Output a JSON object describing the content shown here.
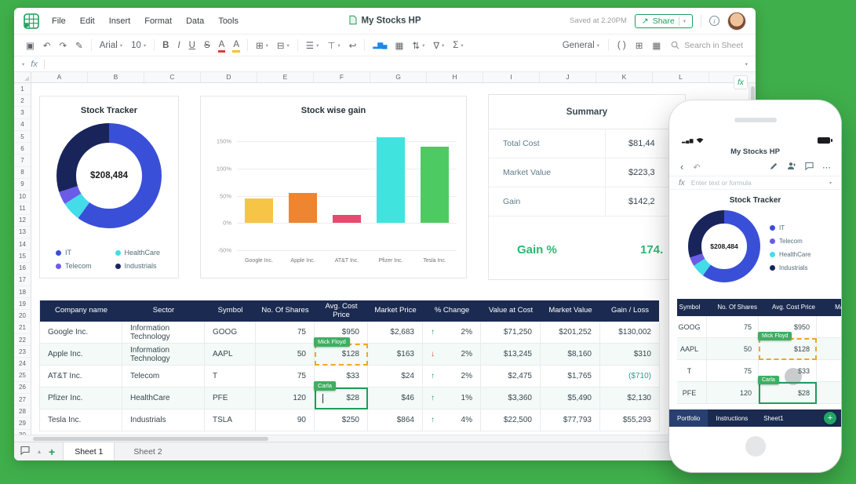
{
  "app": {
    "menu": [
      "File",
      "Edit",
      "Insert",
      "Format",
      "Data",
      "Tools"
    ],
    "doc_title": "My Stocks HP",
    "saved": "Saved at 2.20PM",
    "share": "Share",
    "font": "Arial",
    "font_size": "10",
    "number_format": "General",
    "search_placeholder": "Search in Sheet",
    "fx": "fx",
    "columns": [
      "A",
      "B",
      "C",
      "D",
      "E",
      "F",
      "G",
      "H",
      "I",
      "J",
      "K",
      "L"
    ],
    "row_numbers": [
      "1",
      "2",
      "3",
      "4",
      "5",
      "6",
      "7",
      "8",
      "9",
      "10",
      "11",
      "12",
      "13",
      "14",
      "15",
      "16",
      "17",
      "18",
      "19",
      "20",
      "21",
      "22",
      "23",
      "24",
      "25",
      "26",
      "27",
      "28",
      "29",
      "30"
    ],
    "tabs": [
      "Sheet 1",
      "Sheet 2"
    ]
  },
  "icons": {
    "print": "▣",
    "undo": "↶",
    "redo": "↷",
    "paint": "✎",
    "bold": "B",
    "italic": "I",
    "underline": "U",
    "strike": "S",
    "fontcolor": "A",
    "fillcolor": "A",
    "borders": "⊞",
    "merge": "⊟",
    "align": "☰",
    "valign": "⊤",
    "wrap": "↩",
    "chart": "▂▆▄",
    "image": "▦",
    "sort": "⇅",
    "filter": "∇",
    "sum": "Σ",
    "paren": "( )",
    "grid9": "⊞",
    "keypad": "▦",
    "info": "i",
    "share_arrow": "↗",
    "up": "↑",
    "down": "↓",
    "back": "‹",
    "more": "⋯",
    "plus": "+",
    "tri": "▴",
    "signal": "▂▄▆",
    "chev": "▾"
  },
  "legend": [
    {
      "label": "IT",
      "color": "#3a4fd8"
    },
    {
      "label": "Telecom",
      "color": "#6b5ce7"
    },
    {
      "label": "HealthCare",
      "color": "#43dce8"
    },
    {
      "label": "Industrials",
      "color": "#19255a"
    }
  ],
  "chart_data": [
    {
      "id": "donut-main",
      "type": "pie",
      "title": "Stock Tracker",
      "center_label": "$208,484",
      "slices": [
        {
          "label": "IT",
          "value": 60,
          "color": "#3a4fd8"
        },
        {
          "label": "HealthCare",
          "value": 6,
          "color": "#43dce8"
        },
        {
          "label": "Telecom",
          "value": 4,
          "color": "#6b5ce7"
        },
        {
          "label": "Industrials",
          "value": 30,
          "color": "#19255a"
        }
      ],
      "legend_order": [
        "IT",
        "Telecom",
        "HealthCare",
        "Industrials"
      ],
      "legend_position": "bottom"
    },
    {
      "id": "bar-gain",
      "type": "bar",
      "title": "Stock wise gain",
      "categories": [
        "Google Inc.",
        "Apple Inc.",
        "AT&T Inc.",
        "Pfizer Inc.",
        "Tesla Inc."
      ],
      "values": [
        45,
        56,
        15,
        157,
        140
      ],
      "colors": [
        "#f7c546",
        "#ee8531",
        "#e84a6f",
        "#40e3de",
        "#4dcb62"
      ],
      "ylim": [
        -50,
        175
      ],
      "tick_values": [
        150,
        100,
        50,
        0,
        -50
      ],
      "tick_labels": [
        "150%",
        "100%",
        "50%",
        "0%",
        "-50%"
      ],
      "xlabel": "",
      "ylabel": "",
      "grid": true,
      "legend_position": "none"
    },
    {
      "id": "donut-phone",
      "type": "pie",
      "title": "Stock Tracker",
      "center_label": "$208,484",
      "slices": [
        {
          "label": "IT",
          "value": 60,
          "color": "#3a4fd8"
        },
        {
          "label": "HealthCare",
          "value": 6,
          "color": "#43dce8"
        },
        {
          "label": "Telecom",
          "value": 4,
          "color": "#6b5ce7"
        },
        {
          "label": "Industrials",
          "value": 30,
          "color": "#19255a"
        }
      ],
      "legend_order": [
        "IT",
        "Telecom",
        "HealthCare",
        "Industrials"
      ],
      "legend_position": "right"
    }
  ],
  "summary": {
    "title": "Summary",
    "rows": [
      {
        "label": "Total Cost",
        "value": "$81,44"
      },
      {
        "label": "Market Value",
        "value": "$223,3"
      },
      {
        "label": "Gain",
        "value": "$142,2"
      }
    ],
    "gain_label": "Gain %",
    "gain_value": "174."
  },
  "table": {
    "headers": [
      "Company name",
      "Sector",
      "Symbol",
      "No. Of Shares",
      "Avg. Cost Price",
      "Market Price",
      "% Change",
      "Value at Cost",
      "Market Value",
      "Gain / Loss"
    ],
    "rows": [
      {
        "company": "Google Inc.",
        "sector": "Information Technology",
        "symbol": "GOOG",
        "shares": "75",
        "avg_cost": "$950",
        "market_price": "$2,683",
        "change": "2%",
        "dir": "up",
        "value_at_cost": "$71,250",
        "market_value": "$201,252",
        "gain": "$130,002"
      },
      {
        "company": "Apple Inc.",
        "sector": "Information Technology",
        "symbol": "AAPL",
        "shares": "50",
        "avg_cost": "$128",
        "market_price": "$163",
        "change": "2%",
        "dir": "down",
        "value_at_cost": "$13,245",
        "market_value": "$8,160",
        "gain": "$310",
        "note": "Mick Floyd"
      },
      {
        "company": "AT&T Inc.",
        "sector": "Telecom",
        "symbol": "T",
        "shares": "75",
        "avg_cost": "$33",
        "market_price": "$24",
        "change": "2%",
        "dir": "up",
        "value_at_cost": "$2,475",
        "market_value": "$1,765",
        "gain": "($710)"
      },
      {
        "company": "Pfizer Inc.",
        "sector": "HealthCare",
        "symbol": "PFE",
        "shares": "120",
        "avg_cost": "$28",
        "market_price": "$46",
        "change": "1%",
        "dir": "up",
        "value_at_cost": "$3,360",
        "market_value": "$5,490",
        "gain": "$2,130",
        "note": "Carla"
      },
      {
        "company": "Tesla Inc.",
        "sector": "Industrials",
        "symbol": "TSLA",
        "shares": "90",
        "avg_cost": "$250",
        "market_price": "$864",
        "change": "4%",
        "dir": "up",
        "value_at_cost": "$22,500",
        "market_value": "$77,793",
        "gain": "$55,293"
      }
    ]
  },
  "phone": {
    "title": "My Stocks HP",
    "formula_placeholder": "Enter text or formula",
    "chart_title": "Stock Tracker",
    "tabs": [
      "Portfolio",
      "Instructions",
      "Sheet1"
    ]
  },
  "colors": {
    "background": "#3faf4b",
    "accent_green": "#1e9e5a",
    "table_header_navy": "#1b2a50",
    "gain_green": "#2eb673",
    "negative_value": "#2aa38c",
    "annotation_orange": "#f5a623",
    "tag_green": "#3fae62"
  }
}
